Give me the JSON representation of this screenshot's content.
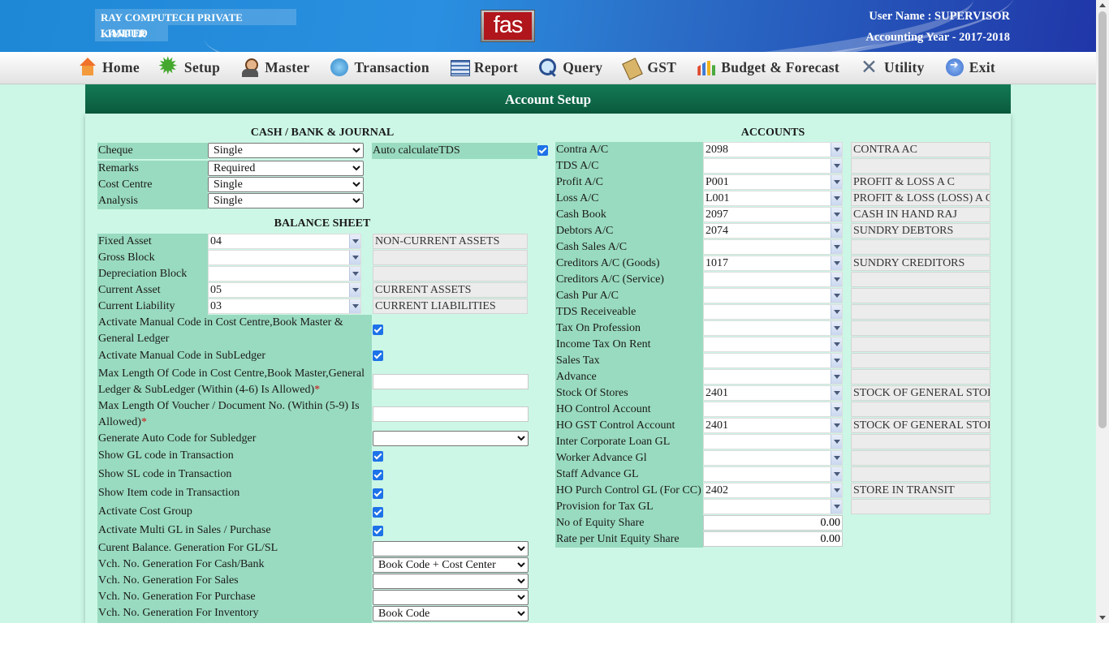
{
  "header": {
    "company_line1": "RAY COMPUTECH PRIVATE LIMITED",
    "company_line2": "KANPUR",
    "logo_text": "fas",
    "user_name": "User Name : SUPERVISOR",
    "accounting_year": "Accounting Year - 2017-2018"
  },
  "nav": [
    {
      "label": "Home",
      "icon": "home-icon"
    },
    {
      "label": "Setup",
      "icon": "gear-icon"
    },
    {
      "label": "Master",
      "icon": "user-icon"
    },
    {
      "label": "Transaction",
      "icon": "transaction-icon"
    },
    {
      "label": "Report",
      "icon": "report-icon"
    },
    {
      "label": "Query",
      "icon": "magnifier-icon"
    },
    {
      "label": "GST",
      "icon": "book-icon"
    },
    {
      "label": "Budget & Forecast",
      "icon": "bar-chart-icon"
    },
    {
      "label": "Utility",
      "icon": "tools-icon"
    },
    {
      "label": "Exit",
      "icon": "exit-icon"
    }
  ],
  "page_title": "Account Setup",
  "cash_bank": {
    "heading": "CASH / BANK & JOURNAL",
    "cheque": {
      "label": "Cheque",
      "value": "Single"
    },
    "remarks": {
      "label": "Remarks",
      "value": "Required"
    },
    "cost_centre": {
      "label": "Cost Centre",
      "value": "Single"
    },
    "analysis": {
      "label": "Analysis",
      "value": "Single"
    },
    "auto_tds": {
      "label": "Auto calculateTDS",
      "checked": true
    }
  },
  "balance_sheet": {
    "heading": "BALANCE SHEET",
    "fixed_asset": {
      "label": "Fixed Asset",
      "code": "04",
      "desc": "NON-CURRENT ASSETS"
    },
    "gross_block": {
      "label": "Gross Block",
      "code": "",
      "desc": ""
    },
    "depreciation_block": {
      "label": "Depreciation Block",
      "code": "",
      "desc": ""
    },
    "current_asset": {
      "label": "Current Asset",
      "code": "05",
      "desc": "CURRENT ASSETS"
    },
    "current_liability": {
      "label": "Current Liability",
      "code": "03",
      "desc": "CURRENT LIABILITIES"
    }
  },
  "options": {
    "manual_code_cc": {
      "label1": "Activate Manual Code in Cost Centre,Book Master &",
      "label2": "General Ledger",
      "checked": true
    },
    "manual_code_sl": {
      "label": "Activate Manual Code in SubLedger",
      "checked": true
    },
    "max_len_code": {
      "label1": "Max Length Of Code in Cost Centre,Book Master,General",
      "label2": "Ledger & SubLedger (Within (4-6) Is Allowed)",
      "required": "*",
      "value": ""
    },
    "max_len_voucher": {
      "label1": "Max Length Of Voucher / Document No. (Within (5-9) Is",
      "label2": "Allowed)",
      "required": "*",
      "value": ""
    },
    "auto_code_sl": {
      "label": "Generate Auto Code for Subledger",
      "value": ""
    },
    "show_gl": {
      "label": "Show GL code in Transaction",
      "checked": true
    },
    "show_sl": {
      "label": "Show SL code in Transaction",
      "checked": true
    },
    "show_item": {
      "label": "Show Item code in Transaction",
      "checked": true
    },
    "cost_group": {
      "label": "Activate Cost Group",
      "checked": true
    },
    "multi_gl": {
      "label": "Activate Multi GL in Sales / Purchase",
      "checked": true
    },
    "curr_balance": {
      "label": "Curent Balance. Generation For GL/SL",
      "value": ""
    },
    "vch_cash_bank": {
      "label": "Vch. No. Generation For Cash/Bank",
      "value": "Book Code + Cost Center"
    },
    "vch_sales": {
      "label": "Vch. No. Generation For Sales",
      "value": ""
    },
    "vch_purchase": {
      "label": "Vch. No. Generation For Purchase",
      "value": ""
    },
    "vch_inventory": {
      "label": "Vch. No. Generation For Inventory",
      "value": "Book Code"
    }
  },
  "accounts": {
    "heading": "ACCOUNTS",
    "rows": [
      {
        "label": "Contra A/C",
        "code": "2098",
        "desc": "CONTRA AC"
      },
      {
        "label": "TDS A/C",
        "code": "",
        "desc": ""
      },
      {
        "label": "Profit A/C",
        "code": "P001",
        "desc": "PROFIT & LOSS A C"
      },
      {
        "label": "Loss A/C",
        "code": "L001",
        "desc": "PROFIT & LOSS (LOSS) A C"
      },
      {
        "label": "Cash Book",
        "code": "2097",
        "desc": "CASH IN HAND RAJ"
      },
      {
        "label": "Debtors A/C",
        "code": "2074",
        "desc": "SUNDRY DEBTORS"
      },
      {
        "label": "Cash Sales A/C",
        "code": "",
        "desc": ""
      },
      {
        "label": "Creditors A/C (Goods)",
        "code": "1017",
        "desc": "SUNDRY CREDITORS"
      },
      {
        "label": "Creditors A/C (Service)",
        "code": "",
        "desc": ""
      },
      {
        "label": "Cash Pur A/C",
        "code": "",
        "desc": ""
      },
      {
        "label": "TDS Receiveable",
        "code": "",
        "desc": ""
      },
      {
        "label": "Tax On Profession",
        "code": "",
        "desc": ""
      },
      {
        "label": "Income Tax On Rent",
        "code": "",
        "desc": ""
      },
      {
        "label": "Sales Tax",
        "code": "",
        "desc": ""
      },
      {
        "label": "Advance",
        "code": "",
        "desc": ""
      },
      {
        "label": "Stock Of Stores",
        "code": "2401",
        "desc": "STOCK OF GENERAL STORES"
      },
      {
        "label": "HO Control Account",
        "code": "",
        "desc": ""
      },
      {
        "label": "HO GST Control Account",
        "code": "2401",
        "desc": "STOCK OF GENERAL STORES"
      },
      {
        "label": "Inter Corporate Loan GL",
        "code": "",
        "desc": ""
      },
      {
        "label": "Worker Advance Gl",
        "code": "",
        "desc": ""
      },
      {
        "label": "Staff Advance GL",
        "code": "",
        "desc": ""
      },
      {
        "label": "HO Purch Control GL (For CC)",
        "code": "2402",
        "desc": "STORE IN TRANSIT"
      },
      {
        "label": "Provision for Tax GL",
        "code": "",
        "desc": ""
      }
    ],
    "equity_share": {
      "label": "No of Equity Share",
      "value": "0.00"
    },
    "rate_equity": {
      "label": "Rate per Unit Equity Share",
      "value": "0.00"
    }
  }
}
